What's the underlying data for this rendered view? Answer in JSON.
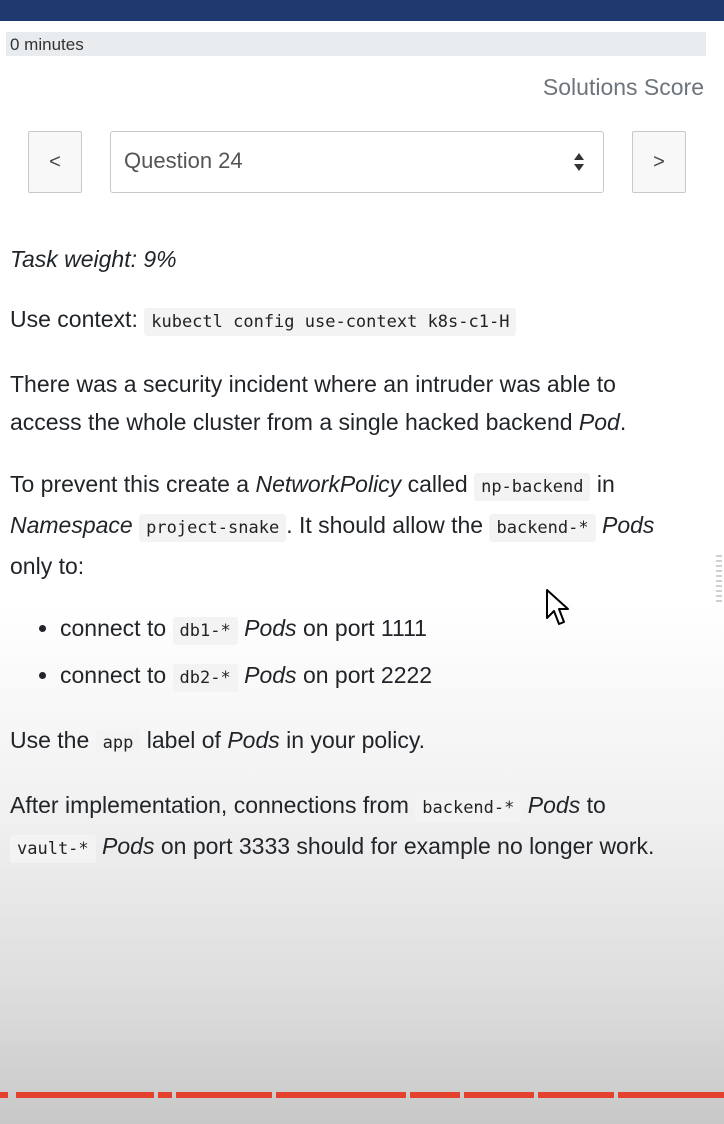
{
  "header": {
    "timer_text": "0 minutes",
    "timer_progress": 0,
    "score_link": "Solutions Score"
  },
  "nav": {
    "prev_label": "<",
    "next_label": ">",
    "selected_question": "Question 24"
  },
  "task": {
    "weight_text": "Task weight: 9%",
    "context_label": "Use context:",
    "context_cmd": "kubectl config use-context k8s-c1-H",
    "p1_a": "There was a security incident where an intruder was able to access the whole cluster from a single hacked backend",
    "p1_pod": "Pod",
    "p1_end": ".",
    "p2_a": "To prevent this create a",
    "p2_np": "NetworkPolicy",
    "p2_b": "called",
    "p2_name": "np-backend",
    "p2_c": "in",
    "p2_ns": "Namespace",
    "p2_ns_value": "project-snake",
    "p2_d": ". It should allow the",
    "p2_backend": "backend-*",
    "p2_pods": "Pods",
    "p2_e": "only to:",
    "bullets": [
      {
        "pre": "connect to",
        "code": "db1-*",
        "pods": "Pods",
        "post": "on port 1111"
      },
      {
        "pre": "connect to",
        "code": "db2-*",
        "pods": "Pods",
        "post": "on port 2222"
      }
    ],
    "p3_a": "Use the",
    "p3_code": "app",
    "p3_b": "label of",
    "p3_pods": "Pods",
    "p3_c": "in your policy.",
    "p4_a": "After implementation, connections from",
    "p4_code1": "backend-*",
    "p4_pods1": "Pods",
    "p4_b": "to",
    "p4_code2": "vault-*",
    "p4_pods2": "Pods",
    "p4_c": "on port 3333 should for example no longer work."
  },
  "colors": {
    "topbar": "#1f3a6e",
    "accent_line": "#e4412f"
  }
}
